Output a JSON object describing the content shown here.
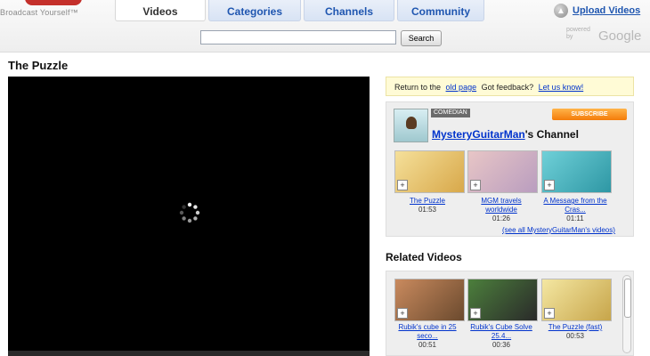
{
  "header": {
    "tagline": "Broadcast Yourself™",
    "tabs": [
      {
        "label": "Videos",
        "active": true
      },
      {
        "label": "Categories",
        "active": false
      },
      {
        "label": "Channels",
        "active": false
      },
      {
        "label": "Community",
        "active": false
      }
    ],
    "upload_label": "Upload Videos",
    "search_button": "Search",
    "search_value": "",
    "powered_by": "powered by",
    "google": "Google"
  },
  "page_title": "The Puzzle",
  "feedback": {
    "text1": "Return to the",
    "old_page": "old page",
    "text2": "Got feedback?",
    "let_us_know": "Let us know!"
  },
  "channel": {
    "badge": "COMEDIAN",
    "subscribe": "SUBSCRIBE",
    "name": "MysteryGuitarMan",
    "suffix": "'s Channel",
    "videos": [
      {
        "title": "The Puzzle",
        "duration": "01:53"
      },
      {
        "title": "MGM travels worldwide",
        "duration": "01:26"
      },
      {
        "title": "A Message from the Cras...",
        "duration": "01:11"
      }
    ],
    "see_all": "(see all MysteryGuitarMan's videos)"
  },
  "related": {
    "heading": "Related Videos",
    "videos": [
      {
        "title": "Rubik's cube in 25 seco...",
        "duration": "00:51"
      },
      {
        "title": "Rubik's Cube Solve 25.4...",
        "duration": "00:36"
      },
      {
        "title": "The Puzzle (fast)",
        "duration": "00:53"
      }
    ]
  },
  "colors": {
    "link": "#0033cc",
    "tab_text": "#1f56b0",
    "subscribe": "#f47c0a",
    "feedback_bg": "#fffbd6"
  }
}
